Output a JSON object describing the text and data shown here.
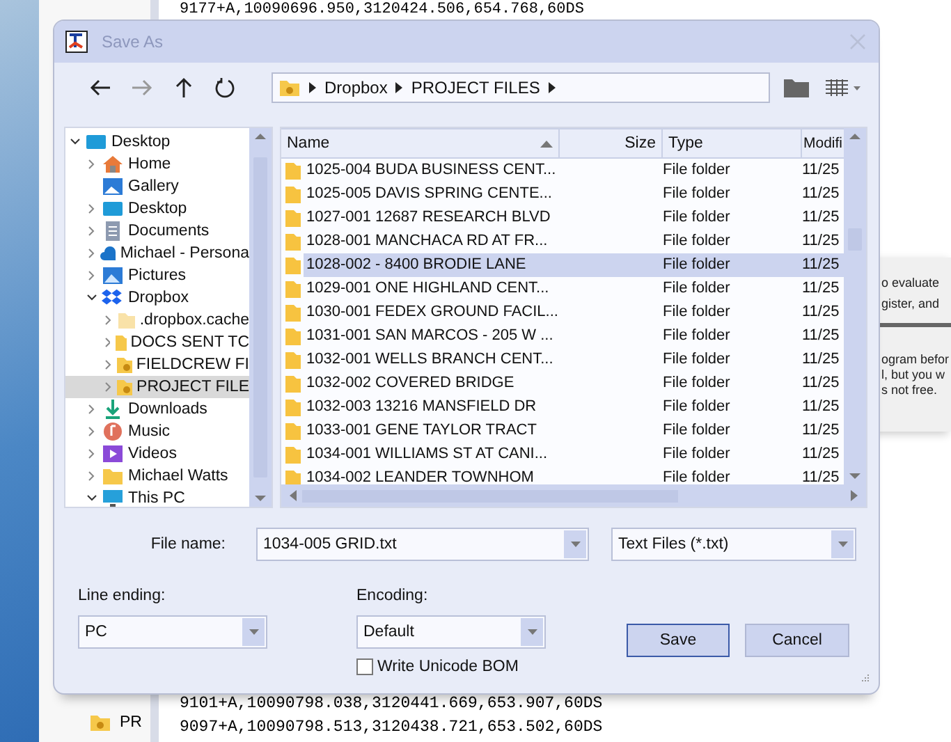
{
  "editor": {
    "lines_top": [
      "9177+A,10090696.950,3120424.506,654.768,60DS"
    ],
    "lines_bottom": [
      "9101+A,10090798.038,3120441.669,653.907,60DS",
      "9097+A,10090798.513,3120438.721,653.502,60DS"
    ]
  },
  "explorer": {
    "items": [
      {
        "label": "PR"
      }
    ]
  },
  "message": {
    "fragments_top": [
      "o evaluate",
      "gister, and"
    ],
    "fragments_bottom": [
      "ogram befor",
      "l, but you w",
      "s not free."
    ]
  },
  "dialog": {
    "title": "Save As",
    "breadcrumb": [
      "Dropbox",
      "PROJECT FILES"
    ],
    "tree": [
      {
        "label": "Desktop",
        "kind": "desktop",
        "expandable": true,
        "expanded": true,
        "selected": false,
        "children": [
          {
            "label": "Home",
            "kind": "home",
            "expandable": true,
            "expanded": false,
            "selected": false
          },
          {
            "label": "Gallery",
            "kind": "gallery",
            "expandable": false,
            "selected": false
          },
          {
            "label": "Desktop",
            "kind": "desktop",
            "expandable": true,
            "expanded": false,
            "selected": false
          },
          {
            "label": "Documents",
            "kind": "documents",
            "expandable": true,
            "expanded": false,
            "selected": false
          },
          {
            "label": "Michael - Persona",
            "kind": "cloud",
            "expandable": true,
            "expanded": false,
            "selected": false
          },
          {
            "label": "Pictures",
            "kind": "pictures",
            "expandable": true,
            "expanded": false,
            "selected": false
          },
          {
            "label": "Dropbox",
            "kind": "dropbox",
            "expandable": true,
            "expanded": true,
            "selected": false,
            "children": [
              {
                "label": ".dropbox.cache",
                "kind": "folder-faded",
                "expandable": true,
                "expanded": false,
                "selected": false
              },
              {
                "label": "DOCS SENT TC",
                "kind": "folder",
                "expandable": true,
                "expanded": false,
                "selected": false
              },
              {
                "label": "FIELDCREW FI",
                "kind": "folder-shared",
                "expandable": true,
                "expanded": false,
                "selected": false
              },
              {
                "label": "PROJECT FILE",
                "kind": "folder-shared",
                "expandable": true,
                "expanded": false,
                "selected": true
              }
            ]
          },
          {
            "label": "Downloads",
            "kind": "downloads",
            "expandable": true,
            "expanded": false,
            "selected": false
          },
          {
            "label": "Music",
            "kind": "music",
            "expandable": true,
            "expanded": false,
            "selected": false
          },
          {
            "label": "Videos",
            "kind": "videos",
            "expandable": true,
            "expanded": false,
            "selected": false
          },
          {
            "label": "Michael Watts",
            "kind": "folder",
            "expandable": true,
            "expanded": false,
            "selected": false
          },
          {
            "label": "This PC",
            "kind": "pc",
            "expandable": true,
            "expanded": true,
            "selected": false
          }
        ]
      }
    ],
    "columns": [
      {
        "label": "Name",
        "sorted": true
      },
      {
        "label": "Size",
        "sorted": false
      },
      {
        "label": "Type",
        "sorted": false
      },
      {
        "label": "Modifi",
        "sorted": false
      }
    ],
    "files": [
      {
        "name": "1025-004 BUDA BUSINESS CENT...",
        "type": "File folder",
        "modified": "11/25",
        "selected": false
      },
      {
        "name": "1025-005 DAVIS SPRING CENTE...",
        "type": "File folder",
        "modified": "11/25",
        "selected": false
      },
      {
        "name": "1027-001 12687 RESEARCH BLVD",
        "type": "File folder",
        "modified": "11/25",
        "selected": false
      },
      {
        "name": "1028-001 MANCHACA RD AT FR...",
        "type": "File folder",
        "modified": "11/25",
        "selected": false
      },
      {
        "name": "1028-002 - 8400 BRODIE LANE",
        "type": "File folder",
        "modified": "11/25",
        "selected": true
      },
      {
        "name": "1029-001 ONE HIGHLAND CENT...",
        "type": "File folder",
        "modified": "11/25",
        "selected": false
      },
      {
        "name": "1030-001 FEDEX GROUND FACIL...",
        "type": "File folder",
        "modified": "11/25",
        "selected": false
      },
      {
        "name": "1031-001 SAN MARCOS - 205 W ...",
        "type": "File folder",
        "modified": "11/25",
        "selected": false
      },
      {
        "name": "1032-001 WELLS BRANCH CENT...",
        "type": "File folder",
        "modified": "11/25",
        "selected": false
      },
      {
        "name": "1032-002 COVERED BRIDGE",
        "type": "File folder",
        "modified": "11/25",
        "selected": false
      },
      {
        "name": "1032-003 13216 MANSFIELD DR",
        "type": "File folder",
        "modified": "11/25",
        "selected": false
      },
      {
        "name": "1033-001 GENE TAYLOR TRACT",
        "type": "File folder",
        "modified": "11/25",
        "selected": false
      },
      {
        "name": "1034-001 WILLIAMS ST AT CANI...",
        "type": "File folder",
        "modified": "11/25",
        "selected": false
      },
      {
        "name": "1034-002 LEANDER TOWNHOM",
        "type": "File folder",
        "modified": "11/25",
        "selected": false
      }
    ],
    "file_name": {
      "label": "File name:",
      "value": "1034-005 GRID.txt"
    },
    "file_type": {
      "value": "Text Files (*.txt)"
    },
    "line_ending": {
      "label": "Line ending:",
      "value": "PC"
    },
    "encoding": {
      "label": "Encoding:",
      "value": "Default"
    },
    "write_bom": {
      "label": "Write Unicode BOM",
      "checked": false
    },
    "buttons": [
      {
        "label": "Save",
        "default": true
      },
      {
        "label": "Cancel",
        "default": false
      }
    ]
  }
}
